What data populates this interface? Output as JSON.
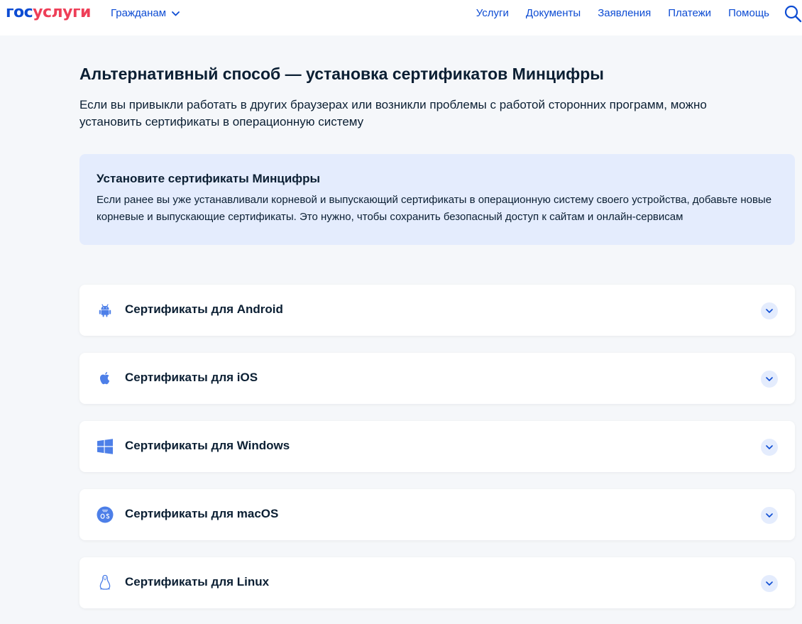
{
  "header": {
    "logo_part1": "гос",
    "logo_part2": "услуги",
    "citizens_label": "Гражданам",
    "nav": [
      "Услуги",
      "Документы",
      "Заявления",
      "Платежи",
      "Помощь"
    ],
    "search_icon": "search-icon"
  },
  "main": {
    "title": "Альтернативный способ — установка сертификатов Минцифры",
    "subtitle": "Если вы привыкли работать в других браузерах или возникли проблемы с работой сторонних программ, можно установить сертификаты в операционную систему"
  },
  "info": {
    "title": "Установите сертификаты Минцифры",
    "text": "Если ранее вы уже устанавливали корневой и выпускающий сертификаты в операционную систему своего устройства, добавьте новые корневые и выпускающие сертификаты. Это нужно, чтобы сохранить безопасный доступ к сайтам и онлайн-сервисам"
  },
  "accordions": [
    {
      "label": "Сертификаты для Android",
      "icon": "android-icon"
    },
    {
      "label": "Сертификаты для iOS",
      "icon": "apple-icon"
    },
    {
      "label": "Сертификаты для Windows",
      "icon": "windows-icon"
    },
    {
      "label": "Сертификаты для macOS",
      "icon": "macos-icon"
    },
    {
      "label": "Сертификаты для Linux",
      "icon": "linux-icon"
    }
  ],
  "colors": {
    "brand_blue": "#0d4cd3",
    "brand_red": "#ee3f58",
    "text_dark": "#0b1f33",
    "info_bg": "#e4ecfd",
    "page_bg": "#f5f7fa",
    "icon_blue": "#4d7fe8"
  }
}
